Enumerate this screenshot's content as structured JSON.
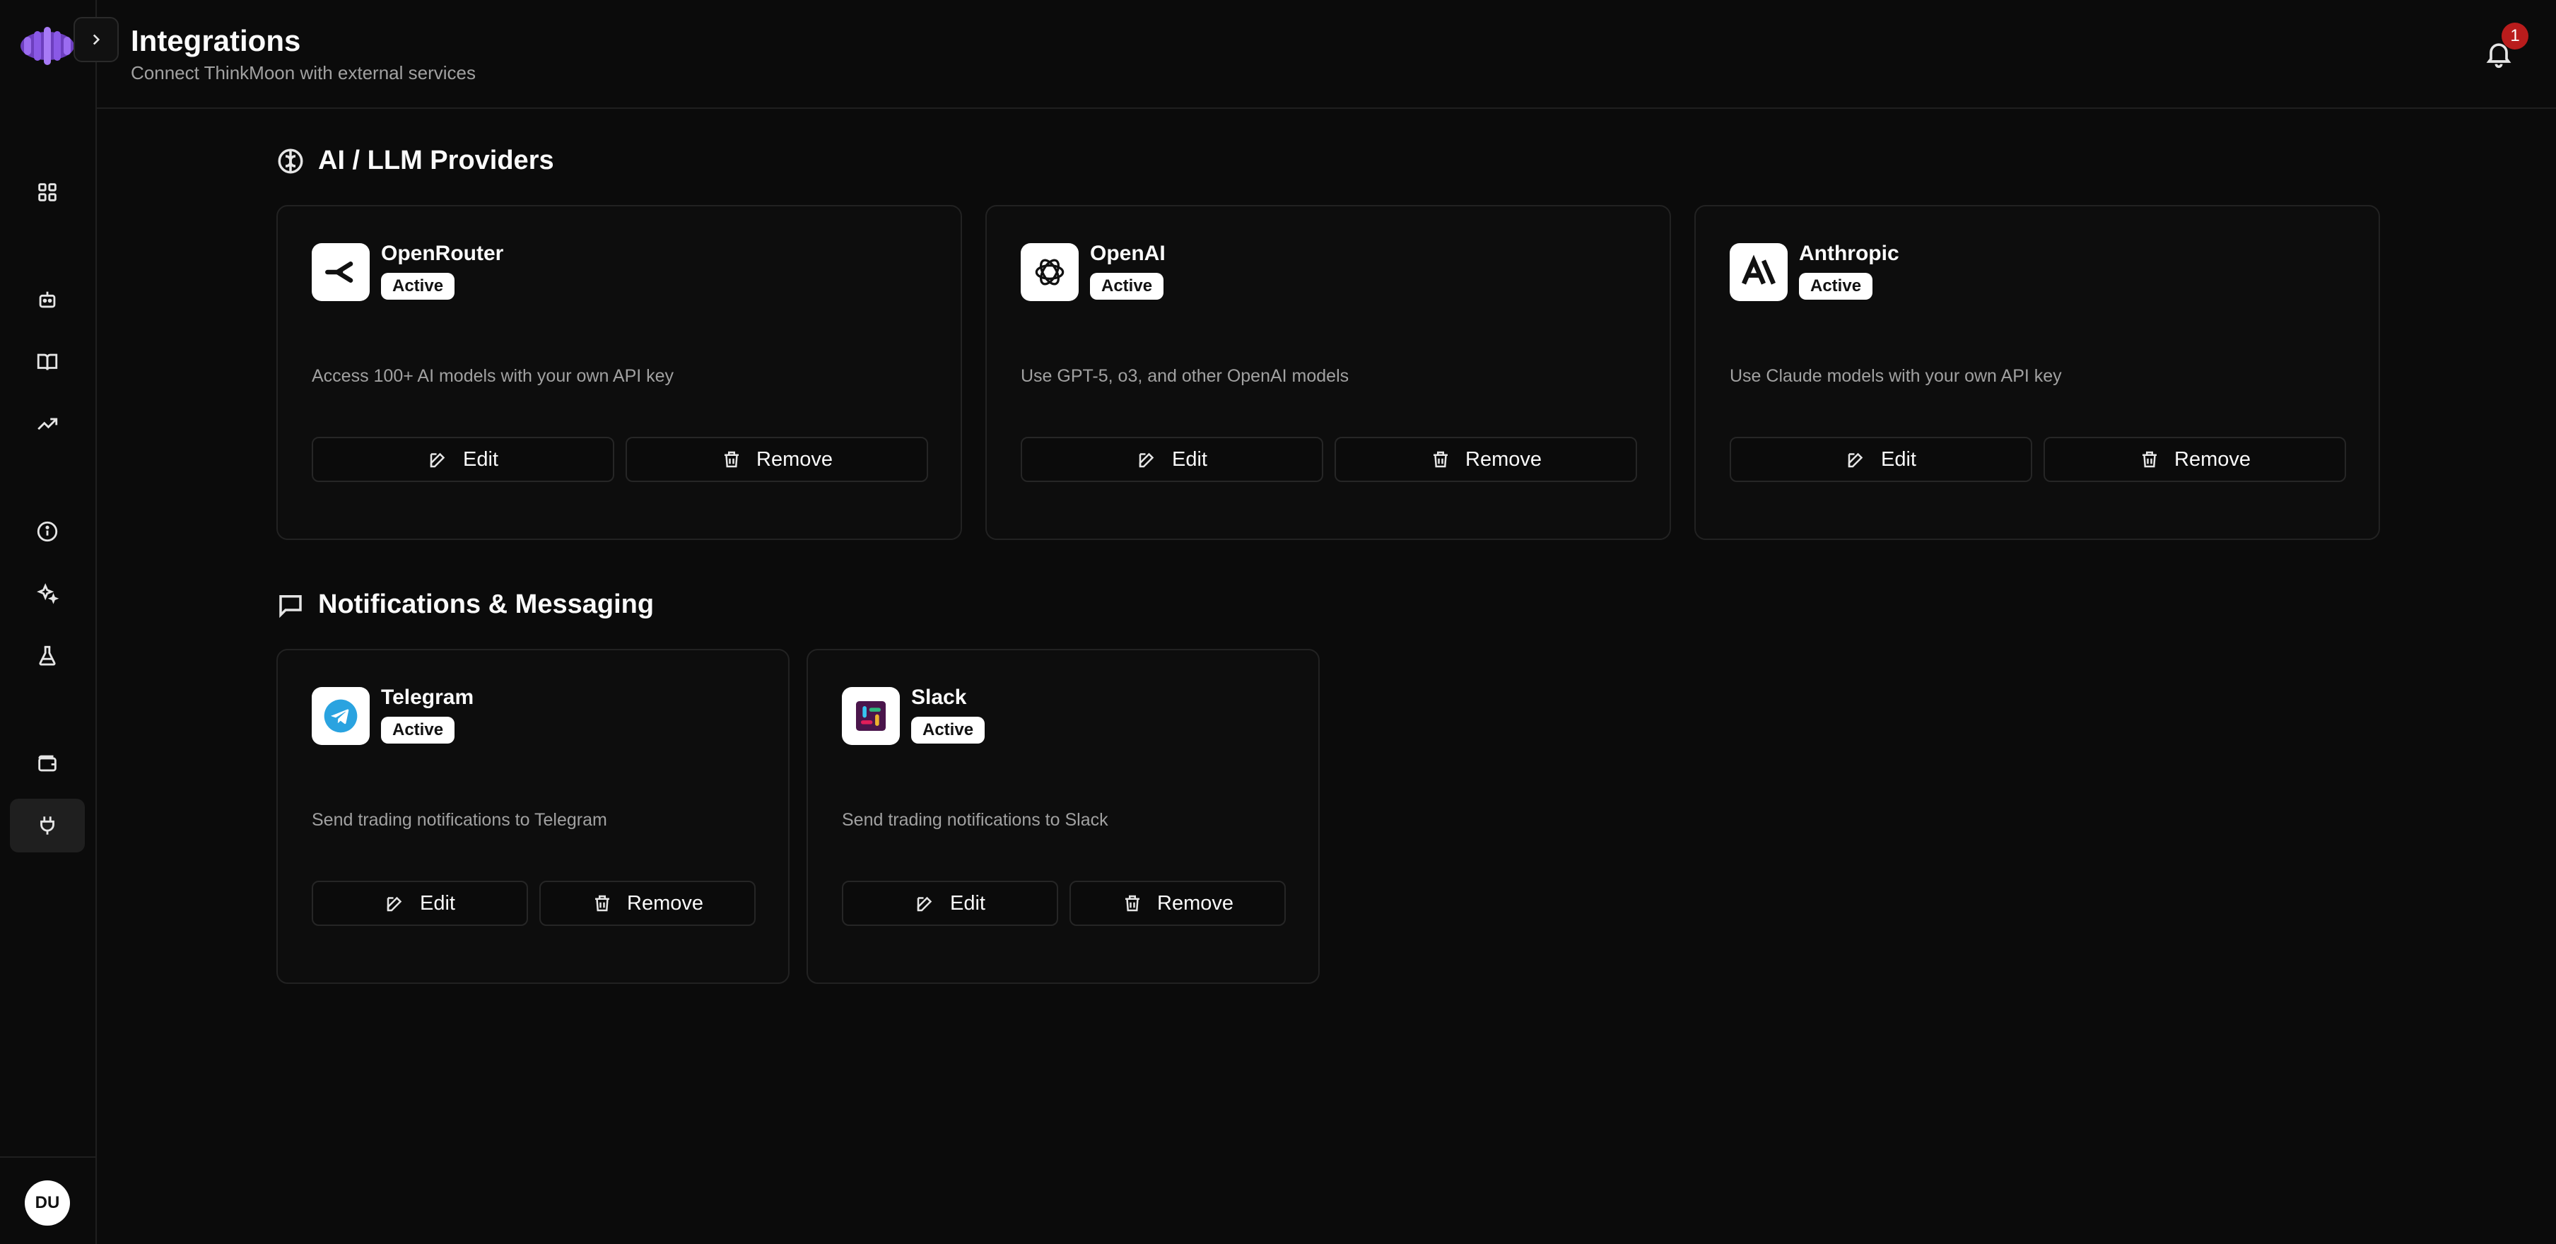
{
  "header": {
    "title": "Integrations",
    "subtitle": "Connect ThinkMoon with external services",
    "notification_count": "1"
  },
  "sidebar": {
    "items": [
      {
        "icon": "grid-icon"
      },
      {
        "icon": "bot-icon"
      },
      {
        "icon": "book-icon"
      },
      {
        "icon": "trending-up-icon"
      },
      {
        "icon": "info-icon"
      },
      {
        "icon": "sparkles-icon"
      },
      {
        "icon": "flask-icon"
      },
      {
        "icon": "wallet-icon"
      },
      {
        "icon": "plug-icon",
        "active": true
      }
    ],
    "avatar_initials": "DU"
  },
  "sections": {
    "ai": {
      "title": "AI / LLM Providers",
      "cards": [
        {
          "name": "OpenRouter",
          "status": "Active",
          "description": "Access 100+ AI models with your own API key",
          "edit_label": "Edit",
          "remove_label": "Remove",
          "logo_icon": "openrouter-logo-icon"
        },
        {
          "name": "OpenAI",
          "status": "Active",
          "description": "Use GPT-5, o3, and other OpenAI models",
          "edit_label": "Edit",
          "remove_label": "Remove",
          "logo_icon": "openai-logo-icon"
        },
        {
          "name": "Anthropic",
          "status": "Active",
          "description": "Use Claude models with your own API key",
          "edit_label": "Edit",
          "remove_label": "Remove",
          "logo_icon": "anthropic-logo-icon"
        }
      ]
    },
    "notifications": {
      "title": "Notifications & Messaging",
      "cards": [
        {
          "name": "Telegram",
          "status": "Active",
          "description": "Send trading notifications to Telegram",
          "edit_label": "Edit",
          "remove_label": "Remove",
          "logo_icon": "telegram-logo-icon"
        },
        {
          "name": "Slack",
          "status": "Active",
          "description": "Send trading notifications to Slack",
          "edit_label": "Edit",
          "remove_label": "Remove",
          "logo_icon": "slack-logo-icon"
        }
      ]
    }
  },
  "colors": {
    "background": "#0b0b0b",
    "accent_logo": "#7c4dcc",
    "badge": "#b91c1c",
    "telegram": "#2aa3e0"
  }
}
